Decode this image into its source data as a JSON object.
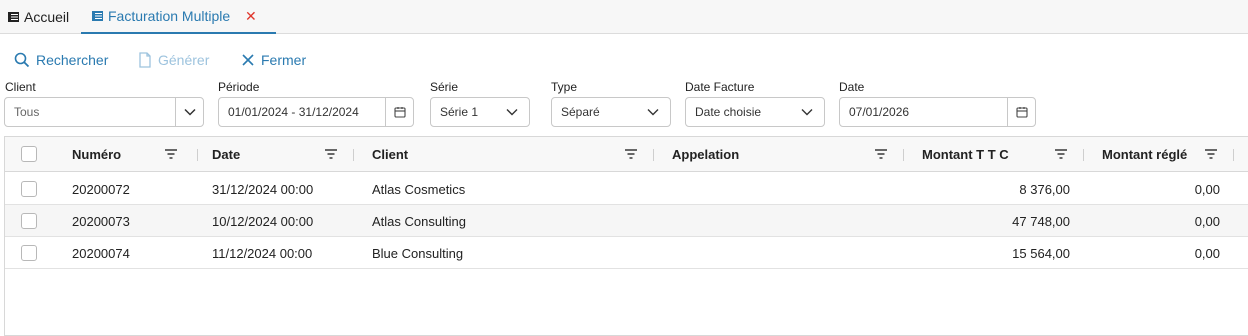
{
  "tabs": {
    "home_label": "Accueil",
    "active_label": "Facturation Multiple",
    "close_glyph": "✕"
  },
  "toolbar": {
    "search_label": "Rechercher",
    "generate_label": "Générer",
    "close_label": "Fermer"
  },
  "filters": {
    "client": {
      "label": "Client",
      "value": "Tous"
    },
    "periode": {
      "label": "Période",
      "value": "01/01/2024 - 31/12/2024"
    },
    "serie": {
      "label": "Série",
      "value": "Série 1"
    },
    "type": {
      "label": "Type",
      "value": "Séparé"
    },
    "date_facture": {
      "label": "Date Facture",
      "value": "Date choisie"
    },
    "date": {
      "label": "Date",
      "value": "07/01/2026"
    }
  },
  "grid": {
    "columns": {
      "numero": "Numéro",
      "date": "Date",
      "client": "Client",
      "appelation": "Appelation",
      "montant_ttc": "Montant T T C",
      "montant_regle": "Montant réglé"
    },
    "rows": [
      {
        "numero": "20200072",
        "date": "31/12/2024 00:00",
        "client": "Atlas Cosmetics",
        "appelation": "",
        "montant_ttc": "8 376,00",
        "montant_regle": "0,00"
      },
      {
        "numero": "20200073",
        "date": "10/12/2024 00:00",
        "client": "Atlas Consulting",
        "appelation": "",
        "montant_ttc": "47 748,00",
        "montant_regle": "0,00"
      },
      {
        "numero": "20200074",
        "date": "11/12/2024 00:00",
        "client": "Blue Consulting",
        "appelation": "",
        "montant_ttc": "15 564,00",
        "montant_regle": "0,00"
      }
    ]
  },
  "colors": {
    "accent": "#2a7ab0",
    "accent_disabled": "#9dc3de",
    "danger": "#e0352b",
    "header_bg": "#f8f8f8",
    "row_alt_bg": "#f6f6f6"
  }
}
